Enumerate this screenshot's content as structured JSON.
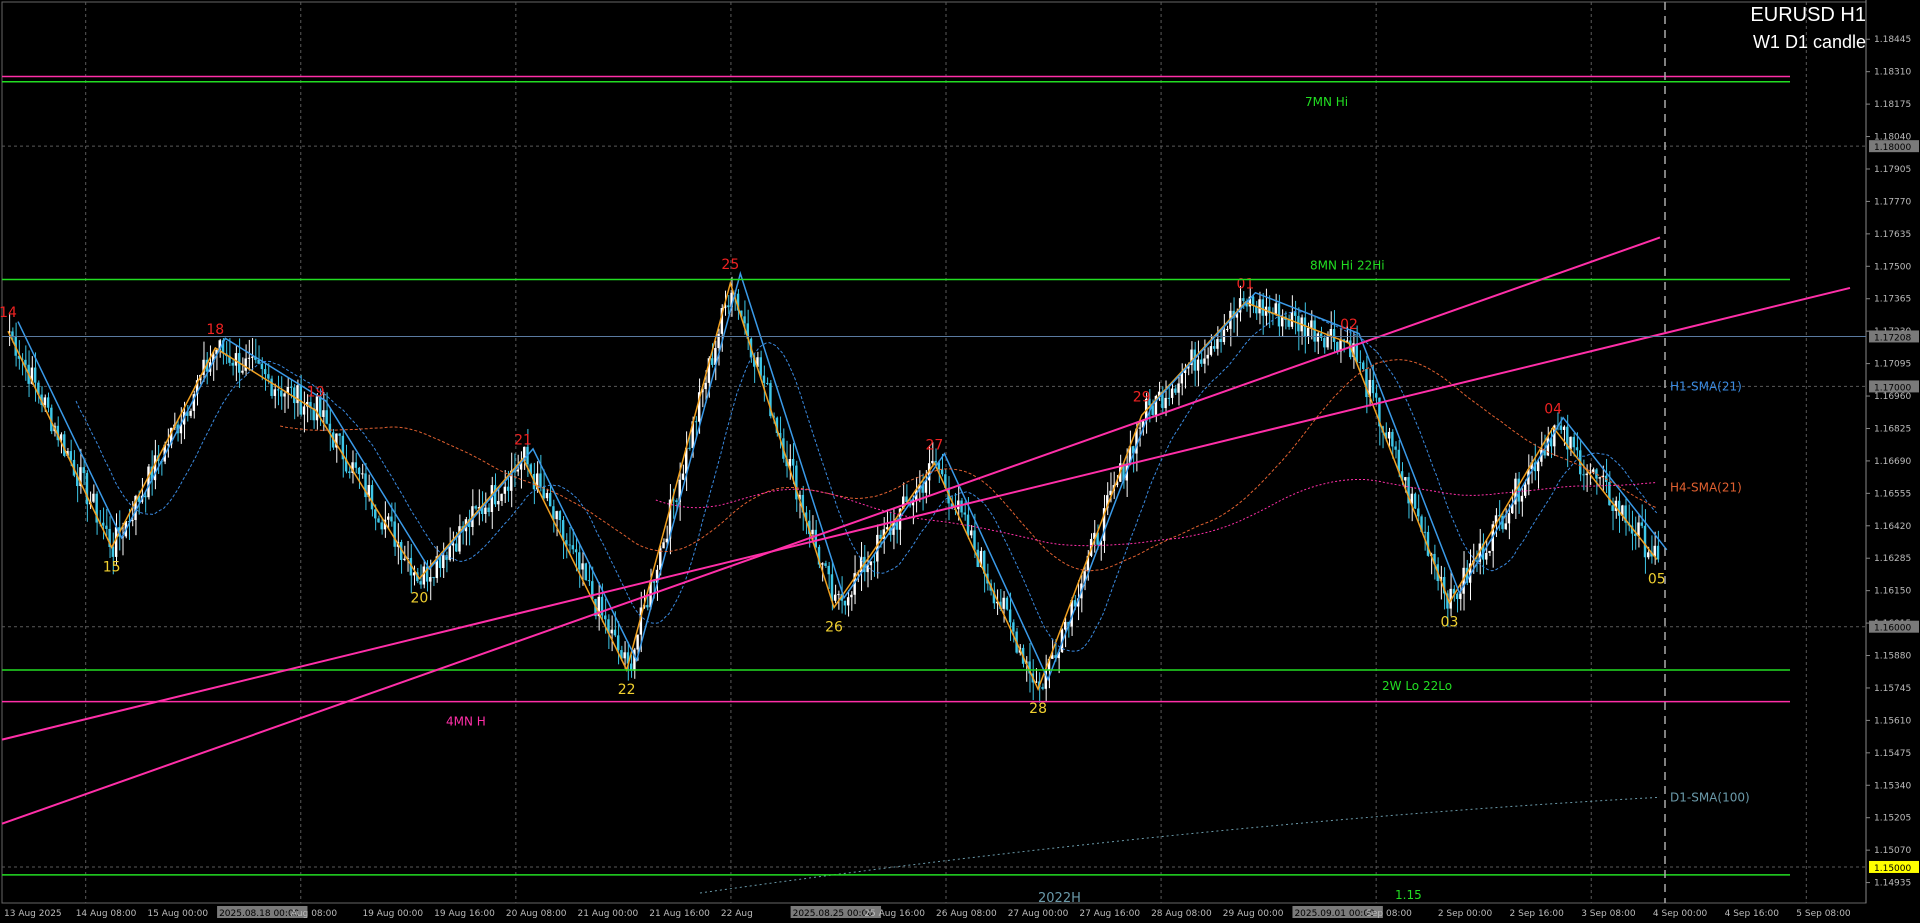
{
  "header": {
    "symbol_timeframe": "EURUSD H1",
    "subtitle": "W1 D1 candle"
  },
  "colors": {
    "background": "#000000",
    "bull_candle": "#ffffff",
    "bear_candle": "#3ec7e8",
    "level_green": "#22dd22",
    "level_magenta": "#ff2fa8",
    "zigzag_orange": "#f0a020",
    "zigzag_blue": "#3a9ae8",
    "box_red": "#cc2222",
    "label_red": "#ee2222",
    "label_yellow": "#f0d030",
    "sma_h1": "#3a8ae0",
    "sma_h4": "#e06030",
    "sma_d1": "#6a9aaa",
    "grid": "#5a5a5a",
    "axis_text": "#bbbbbb"
  },
  "chart_data": {
    "type": "candlestick",
    "title": "EURUSD H1",
    "subtitle": "W1 D1 candle",
    "ylim": [
      1.1485,
      1.186
    ],
    "y_ticks": [
      "1.18445",
      "1.18310",
      "1.18175",
      "1.18040",
      "1.17905",
      "1.17770",
      "1.17635",
      "1.17500",
      "1.17365",
      "1.17230",
      "1.17095",
      "1.16960",
      "1.16825",
      "1.16690",
      "1.16555",
      "1.16420",
      "1.16285",
      "1.16150",
      "1.16015",
      "1.15880",
      "1.15745",
      "1.15610",
      "1.15475",
      "1.15340",
      "1.15205",
      "1.15070",
      "1.14935"
    ],
    "y_ticks_highlighted": [
      {
        "label": "1.18000",
        "value": 1.18
      },
      {
        "label": "1.17208",
        "value": 1.17208
      },
      {
        "label": "1.17000",
        "value": 1.17
      },
      {
        "label": "1.16000",
        "value": 1.16
      },
      {
        "label": "1.15000",
        "value": 1.15
      }
    ],
    "x_ticks": [
      "13 Aug 2025",
      "14 Aug 08:00",
      "15 Aug 00:00",
      "2025.08.18 00:00",
      "Aug 08:00",
      "19 Aug 00:00",
      "19 Aug 16:00",
      "20 Aug 08:00",
      "21 Aug 00:00",
      "21 Aug 16:00",
      "22 Aug",
      "2025.08.25 00:00",
      "25 Aug 16:00",
      "26 Aug 08:00",
      "27 Aug 00:00",
      "27 Aug 16:00",
      "28 Aug 08:00",
      "29 Aug 00:00",
      "2025.09.01 00:00",
      "Sep 08:00",
      "2 Sep 00:00",
      "2 Sep 16:00",
      "3 Sep 08:00",
      "4 Sep 00:00",
      "4 Sep 16:00",
      "5 Sep 08:00"
    ],
    "x_ticks_highlighted": [
      "2025.08.18 00:00",
      "2025.08.25 00:00",
      "2025.09.01 00:00"
    ],
    "swing_points": [
      {
        "label": "14",
        "kind": "high",
        "value": 1.1723
      },
      {
        "label": "15",
        "kind": "low",
        "value": 1.1633
      },
      {
        "label": "18",
        "kind": "high",
        "value": 1.1716
      },
      {
        "label": "19",
        "kind": "high",
        "value": 1.169
      },
      {
        "label": "20",
        "kind": "low",
        "value": 1.162
      },
      {
        "label": "21",
        "kind": "high",
        "value": 1.167
      },
      {
        "label": "22",
        "kind": "low",
        "value": 1.1582
      },
      {
        "label": "25",
        "kind": "high",
        "value": 1.1743
      },
      {
        "label": "26",
        "kind": "low",
        "value": 1.1608
      },
      {
        "label": "27",
        "kind": "high",
        "value": 1.1668
      },
      {
        "label": "28",
        "kind": "low",
        "value": 1.1574
      },
      {
        "label": "29",
        "kind": "high",
        "value": 1.1688
      },
      {
        "label": "01",
        "kind": "high",
        "value": 1.1735
      },
      {
        "label": "02",
        "kind": "high",
        "value": 1.1718
      },
      {
        "label": "03",
        "kind": "low",
        "value": 1.161
      },
      {
        "label": "04",
        "kind": "high",
        "value": 1.1683
      },
      {
        "label": "05",
        "kind": "low",
        "value": 1.1628
      }
    ],
    "horizontal_levels": [
      {
        "name": "7MN Hi",
        "value": 1.18268,
        "color": "#22dd22"
      },
      {
        "name": "8MN Hi  22Hi",
        "value": 1.17445,
        "color": "#22dd22"
      },
      {
        "name": "2W Lo  22Lo",
        "value": 1.1582,
        "color": "#22dd22"
      },
      {
        "name": "1.15",
        "value": 1.14967,
        "color": "#22dd22"
      },
      {
        "name": "4MN H",
        "value": 1.15688,
        "color": "#ff2fa8"
      },
      {
        "name": "",
        "value": 1.1829,
        "color": "#ff2fa8"
      }
    ],
    "indicators": [
      {
        "name": "H1-SMA(21)",
        "value": 1.17
      },
      {
        "name": "H4-SMA(21)",
        "value": 1.1658
      },
      {
        "name": "D1-SMA(100)",
        "value": 1.1529
      }
    ],
    "trendline_note": "2022H",
    "annotations": [
      {
        "text": "7MN Hi"
      },
      {
        "text": "8MN Hi   22Hi"
      },
      {
        "text": "2W Lo   22Lo"
      },
      {
        "text": "4MN H"
      },
      {
        "text": "1.15"
      },
      {
        "text": "2022H"
      },
      {
        "text": "H1-SMA(21)"
      },
      {
        "text": "H4-SMA(21)"
      },
      {
        "text": "D1-SMA(100)"
      }
    ],
    "grid": true,
    "current_price": 1.17208
  }
}
